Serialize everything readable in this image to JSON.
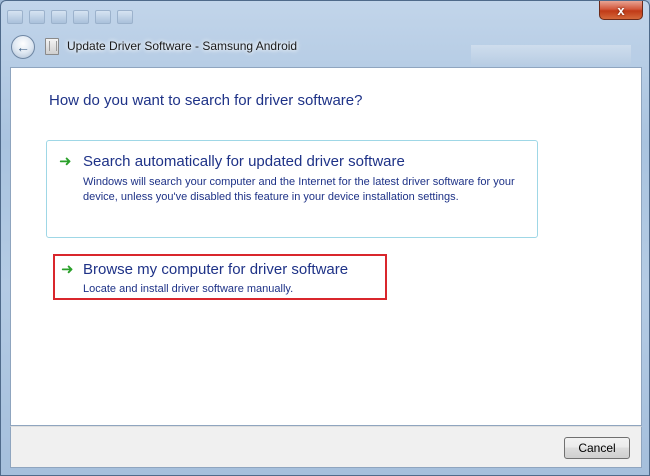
{
  "window": {
    "title": "Update Driver Software - Samsung Android",
    "close_label": "x"
  },
  "main": {
    "question": "How do you want to search for driver software?",
    "options": [
      {
        "icon": "green-arrow-icon",
        "title": "Search automatically for updated driver software",
        "description": "Windows will search your computer and the Internet for the latest driver software for your device, unless you've disabled this feature in your device installation settings."
      },
      {
        "icon": "green-arrow-icon",
        "title": "Browse my computer for driver software",
        "description": "Locate and install driver software manually.",
        "highlight_color": "#d9262c"
      }
    ]
  },
  "footer": {
    "cancel_label": "Cancel"
  },
  "colors": {
    "accent_text": "#1e3287",
    "arrow": "#2aa02a",
    "option_border": "#9fd7e6",
    "highlight": "#d9262c"
  }
}
